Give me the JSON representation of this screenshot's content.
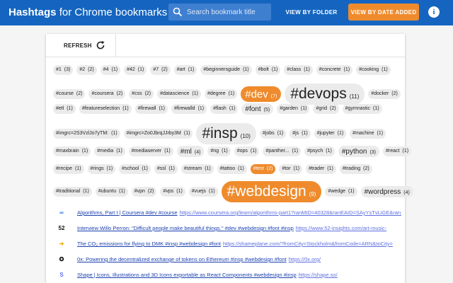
{
  "header": {
    "brand_bold": "Hashtags",
    "brand_rest": "for Chrome bookmarks",
    "search_placeholder": "Search bookmark title",
    "view_folder": "VIEW BY FOLDER",
    "view_date": "VIEW BY DATE ADDED",
    "info": "i"
  },
  "toolbar": {
    "refresh": "REFRESH"
  },
  "tag_rows": [
    [
      [
        "#1",
        "(3)",
        1
      ],
      [
        "#2",
        "(2)",
        1
      ],
      [
        "#4",
        "(1)",
        1
      ],
      [
        "#42",
        "(1)",
        1
      ],
      [
        "#7",
        "(2)",
        1
      ],
      [
        "#art",
        "(1)",
        1
      ],
      [
        "#beginnersguide",
        "(1)",
        1
      ],
      [
        "#bolt",
        "(1)",
        1
      ],
      [
        "#class",
        "(1)",
        1
      ],
      [
        "#concrete",
        "(1)",
        1
      ],
      [
        "#cooking",
        "(1)",
        1
      ]
    ],
    [
      [
        "#course",
        "(2)",
        1
      ],
      [
        "#coursera",
        "(2)",
        1
      ],
      [
        "#css",
        "(2)",
        1
      ],
      [
        "#datascience",
        "(1)",
        1
      ],
      [
        "#degree",
        "(1)",
        1
      ],
      [
        "#dev",
        "(7)",
        3,
        true
      ],
      [
        "#devops",
        "(11)",
        4
      ],
      [
        "#docker",
        "(2)",
        1
      ]
    ],
    [
      [
        "#etl",
        "(1)",
        1
      ],
      [
        "#featureselection",
        "(1)",
        1
      ],
      [
        "#firewall",
        "(1)",
        1
      ],
      [
        "#firewalld",
        "(1)",
        1
      ],
      [
        "#flash",
        "(1)",
        1
      ],
      [
        "#font",
        "(5)",
        2
      ],
      [
        "#garden",
        "(1)",
        1
      ],
      [
        "#grid",
        "(2)",
        1
      ],
      [
        "#gymnastic",
        "(1)",
        1
      ]
    ],
    [
      [
        "#imgrc=2S3VzlJo7yTM:",
        "(1)",
        1
      ],
      [
        "#imgrc=Zo0JbrqJJrby3M",
        "(1)",
        1
      ],
      [
        "#insp",
        "(10)",
        4
      ],
      [
        "#jobs",
        "(1)",
        1
      ],
      [
        "#js",
        "(1)",
        1
      ],
      [
        "#jupyter",
        "(1)",
        1
      ],
      [
        "#machine",
        "(1)",
        1
      ]
    ],
    [
      [
        "#maxbrain",
        "(1)",
        1
      ],
      [
        "#media",
        "(1)",
        1
      ],
      [
        "#mediaserver",
        "(1)",
        1
      ],
      [
        "#ml",
        "(4)",
        2
      ],
      [
        "#ng",
        "(1)",
        1
      ],
      [
        "#ops",
        "(1)",
        1
      ],
      [
        "#panther...",
        "(1)",
        1
      ],
      [
        "#psych",
        "(1)",
        1
      ],
      [
        "#python",
        "(3)",
        2
      ],
      [
        "#react",
        "(1)",
        1
      ]
    ],
    [
      [
        "#recipe",
        "(1)",
        1
      ],
      [
        "#rings",
        "(1)",
        1
      ],
      [
        "#school",
        "(1)",
        1
      ],
      [
        "#ssl",
        "(1)",
        1
      ],
      [
        "#stream",
        "(1)",
        1
      ],
      [
        "#tattoo",
        "(1)",
        1
      ],
      [
        "#test",
        "(2)",
        1,
        true
      ],
      [
        "#tor",
        "(1)",
        1
      ],
      [
        "#trader",
        "(1)",
        1
      ],
      [
        "#trading",
        "(2)",
        1
      ]
    ],
    [
      [
        "#traditional",
        "(1)",
        1
      ],
      [
        "#ubuntu",
        "(1)",
        1
      ],
      [
        "#vpn",
        "(2)",
        1
      ],
      [
        "#vps",
        "(1)",
        1
      ],
      [
        "#vuejs",
        "(1)",
        1
      ],
      [
        "#webdesign",
        "(9)",
        4,
        true
      ],
      [
        "#wedge",
        "(1)",
        1
      ],
      [
        "#wordpress",
        "(4)",
        2
      ]
    ]
  ],
  "bookmarks": [
    {
      "icon": "infinity-icon",
      "glyph": "∞",
      "color": "#2a73d8",
      "link": "Algorithms, Part I | Coursera #dev #course",
      "url": "https://www.coursera.org/learn/algorithms-part1?ranMID=40328&ranEAID=SAyYsTvLiGE&ranSiteID="
    },
    {
      "icon": "52-logo-icon",
      "glyph": "52",
      "color": "#111111",
      "link": "Interview Willo Perron: \"Difficult people make beautiful things.\" #dev #webdesign #font #insp",
      "url": "https://www.52-insights.com/art-music-"
    },
    {
      "icon": "arrow-circle-icon",
      "glyph": "➔",
      "color": "#f2a900",
      "link": "The CO₂ emissions for flying to DMK #insp #webdesign #font",
      "url": "https://shameplane.com/?fromCity=Stockholm&fromCode=ARN&toCity="
    },
    {
      "icon": "0x-logo-icon",
      "glyph": "✪",
      "color": "#111111",
      "link": "0x: Powering the decentralized exchange of tokens on Ethereum #insp #webdesign #font",
      "url": "https://0x.org/"
    },
    {
      "icon": "shape-logo-icon",
      "glyph": "S",
      "color": "#5a6ff0",
      "link": "Shape | Icons, Illustrations and 3D Icons exportable as React Components #webdesign #insp",
      "url": "https://shape.so/"
    }
  ]
}
